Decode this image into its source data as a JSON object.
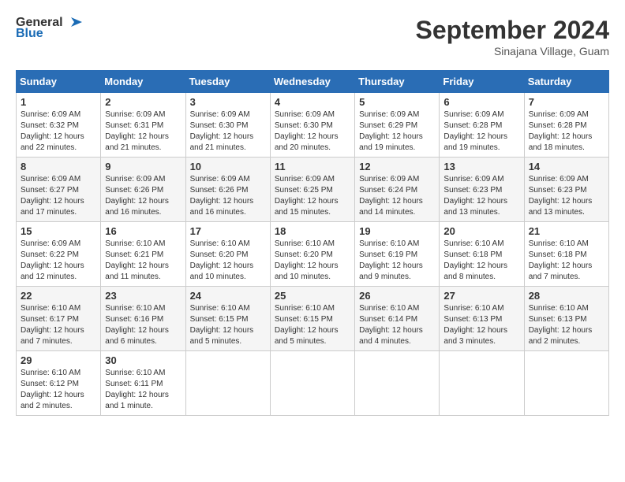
{
  "header": {
    "logo_line1": "General",
    "logo_line2": "Blue",
    "month": "September 2024",
    "location": "Sinajana Village, Guam"
  },
  "weekdays": [
    "Sunday",
    "Monday",
    "Tuesday",
    "Wednesday",
    "Thursday",
    "Friday",
    "Saturday"
  ],
  "weeks": [
    [
      {
        "day": "1",
        "sunrise": "Sunrise: 6:09 AM",
        "sunset": "Sunset: 6:32 PM",
        "daylight": "Daylight: 12 hours and 22 minutes."
      },
      {
        "day": "2",
        "sunrise": "Sunrise: 6:09 AM",
        "sunset": "Sunset: 6:31 PM",
        "daylight": "Daylight: 12 hours and 21 minutes."
      },
      {
        "day": "3",
        "sunrise": "Sunrise: 6:09 AM",
        "sunset": "Sunset: 6:30 PM",
        "daylight": "Daylight: 12 hours and 21 minutes."
      },
      {
        "day": "4",
        "sunrise": "Sunrise: 6:09 AM",
        "sunset": "Sunset: 6:30 PM",
        "daylight": "Daylight: 12 hours and 20 minutes."
      },
      {
        "day": "5",
        "sunrise": "Sunrise: 6:09 AM",
        "sunset": "Sunset: 6:29 PM",
        "daylight": "Daylight: 12 hours and 19 minutes."
      },
      {
        "day": "6",
        "sunrise": "Sunrise: 6:09 AM",
        "sunset": "Sunset: 6:28 PM",
        "daylight": "Daylight: 12 hours and 19 minutes."
      },
      {
        "day": "7",
        "sunrise": "Sunrise: 6:09 AM",
        "sunset": "Sunset: 6:28 PM",
        "daylight": "Daylight: 12 hours and 18 minutes."
      }
    ],
    [
      {
        "day": "8",
        "sunrise": "Sunrise: 6:09 AM",
        "sunset": "Sunset: 6:27 PM",
        "daylight": "Daylight: 12 hours and 17 minutes."
      },
      {
        "day": "9",
        "sunrise": "Sunrise: 6:09 AM",
        "sunset": "Sunset: 6:26 PM",
        "daylight": "Daylight: 12 hours and 16 minutes."
      },
      {
        "day": "10",
        "sunrise": "Sunrise: 6:09 AM",
        "sunset": "Sunset: 6:26 PM",
        "daylight": "Daylight: 12 hours and 16 minutes."
      },
      {
        "day": "11",
        "sunrise": "Sunrise: 6:09 AM",
        "sunset": "Sunset: 6:25 PM",
        "daylight": "Daylight: 12 hours and 15 minutes."
      },
      {
        "day": "12",
        "sunrise": "Sunrise: 6:09 AM",
        "sunset": "Sunset: 6:24 PM",
        "daylight": "Daylight: 12 hours and 14 minutes."
      },
      {
        "day": "13",
        "sunrise": "Sunrise: 6:09 AM",
        "sunset": "Sunset: 6:23 PM",
        "daylight": "Daylight: 12 hours and 13 minutes."
      },
      {
        "day": "14",
        "sunrise": "Sunrise: 6:09 AM",
        "sunset": "Sunset: 6:23 PM",
        "daylight": "Daylight: 12 hours and 13 minutes."
      }
    ],
    [
      {
        "day": "15",
        "sunrise": "Sunrise: 6:09 AM",
        "sunset": "Sunset: 6:22 PM",
        "daylight": "Daylight: 12 hours and 12 minutes."
      },
      {
        "day": "16",
        "sunrise": "Sunrise: 6:10 AM",
        "sunset": "Sunset: 6:21 PM",
        "daylight": "Daylight: 12 hours and 11 minutes."
      },
      {
        "day": "17",
        "sunrise": "Sunrise: 6:10 AM",
        "sunset": "Sunset: 6:20 PM",
        "daylight": "Daylight: 12 hours and 10 minutes."
      },
      {
        "day": "18",
        "sunrise": "Sunrise: 6:10 AM",
        "sunset": "Sunset: 6:20 PM",
        "daylight": "Daylight: 12 hours and 10 minutes."
      },
      {
        "day": "19",
        "sunrise": "Sunrise: 6:10 AM",
        "sunset": "Sunset: 6:19 PM",
        "daylight": "Daylight: 12 hours and 9 minutes."
      },
      {
        "day": "20",
        "sunrise": "Sunrise: 6:10 AM",
        "sunset": "Sunset: 6:18 PM",
        "daylight": "Daylight: 12 hours and 8 minutes."
      },
      {
        "day": "21",
        "sunrise": "Sunrise: 6:10 AM",
        "sunset": "Sunset: 6:18 PM",
        "daylight": "Daylight: 12 hours and 7 minutes."
      }
    ],
    [
      {
        "day": "22",
        "sunrise": "Sunrise: 6:10 AM",
        "sunset": "Sunset: 6:17 PM",
        "daylight": "Daylight: 12 hours and 7 minutes."
      },
      {
        "day": "23",
        "sunrise": "Sunrise: 6:10 AM",
        "sunset": "Sunset: 6:16 PM",
        "daylight": "Daylight: 12 hours and 6 minutes."
      },
      {
        "day": "24",
        "sunrise": "Sunrise: 6:10 AM",
        "sunset": "Sunset: 6:15 PM",
        "daylight": "Daylight: 12 hours and 5 minutes."
      },
      {
        "day": "25",
        "sunrise": "Sunrise: 6:10 AM",
        "sunset": "Sunset: 6:15 PM",
        "daylight": "Daylight: 12 hours and 5 minutes."
      },
      {
        "day": "26",
        "sunrise": "Sunrise: 6:10 AM",
        "sunset": "Sunset: 6:14 PM",
        "daylight": "Daylight: 12 hours and 4 minutes."
      },
      {
        "day": "27",
        "sunrise": "Sunrise: 6:10 AM",
        "sunset": "Sunset: 6:13 PM",
        "daylight": "Daylight: 12 hours and 3 minutes."
      },
      {
        "day": "28",
        "sunrise": "Sunrise: 6:10 AM",
        "sunset": "Sunset: 6:13 PM",
        "daylight": "Daylight: 12 hours and 2 minutes."
      }
    ],
    [
      {
        "day": "29",
        "sunrise": "Sunrise: 6:10 AM",
        "sunset": "Sunset: 6:12 PM",
        "daylight": "Daylight: 12 hours and 2 minutes."
      },
      {
        "day": "30",
        "sunrise": "Sunrise: 6:10 AM",
        "sunset": "Sunset: 6:11 PM",
        "daylight": "Daylight: 12 hours and 1 minute."
      },
      null,
      null,
      null,
      null,
      null
    ]
  ]
}
